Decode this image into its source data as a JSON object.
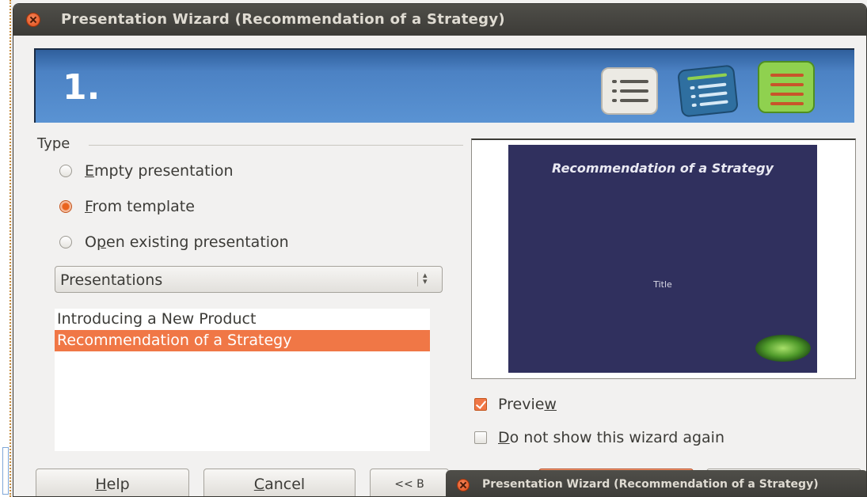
{
  "window": {
    "title": "Presentation Wizard (Recommendation of a Strategy)"
  },
  "banner": {
    "step": "1.",
    "icons": [
      "list-icon",
      "blue-list-icon",
      "green-list-icon"
    ]
  },
  "type_group": {
    "label": "Type",
    "options": [
      {
        "label_pre": "",
        "mnemonic": "E",
        "label_post": "mpty presentation",
        "selected": false
      },
      {
        "label_pre": "",
        "mnemonic": "F",
        "label_post": "rom template",
        "selected": true
      },
      {
        "label_pre": "O",
        "mnemonic": "p",
        "label_post": "en existing presentation",
        "selected": false
      }
    ]
  },
  "category_combo": {
    "value": "Presentations"
  },
  "template_list": {
    "items": [
      "Introducing a New Product",
      "Recommendation of a Strategy"
    ],
    "selected_index": 1
  },
  "preview": {
    "slide_title": "Recommendation of a Strategy",
    "slide_subtitle": "Title",
    "preview_check_pre": "Previe",
    "preview_check_mnemonic": "w",
    "preview_checked": true,
    "no_show_mnemonic": "D",
    "no_show_post": "o not show this wizard again",
    "no_show_checked": false
  },
  "buttons": {
    "help_mnemonic": "H",
    "help_post": "elp",
    "cancel_mnemonic": "C",
    "cancel_post": "ancel",
    "back_label": "<< B"
  },
  "taskbar": {
    "title": "Presentation Wizard (Recommendation of a Strategy)"
  },
  "colors": {
    "accent": "#f07746",
    "titlebar": "#3c3b37",
    "banner": "#4c82c4",
    "slide_bg": "#30305e"
  }
}
